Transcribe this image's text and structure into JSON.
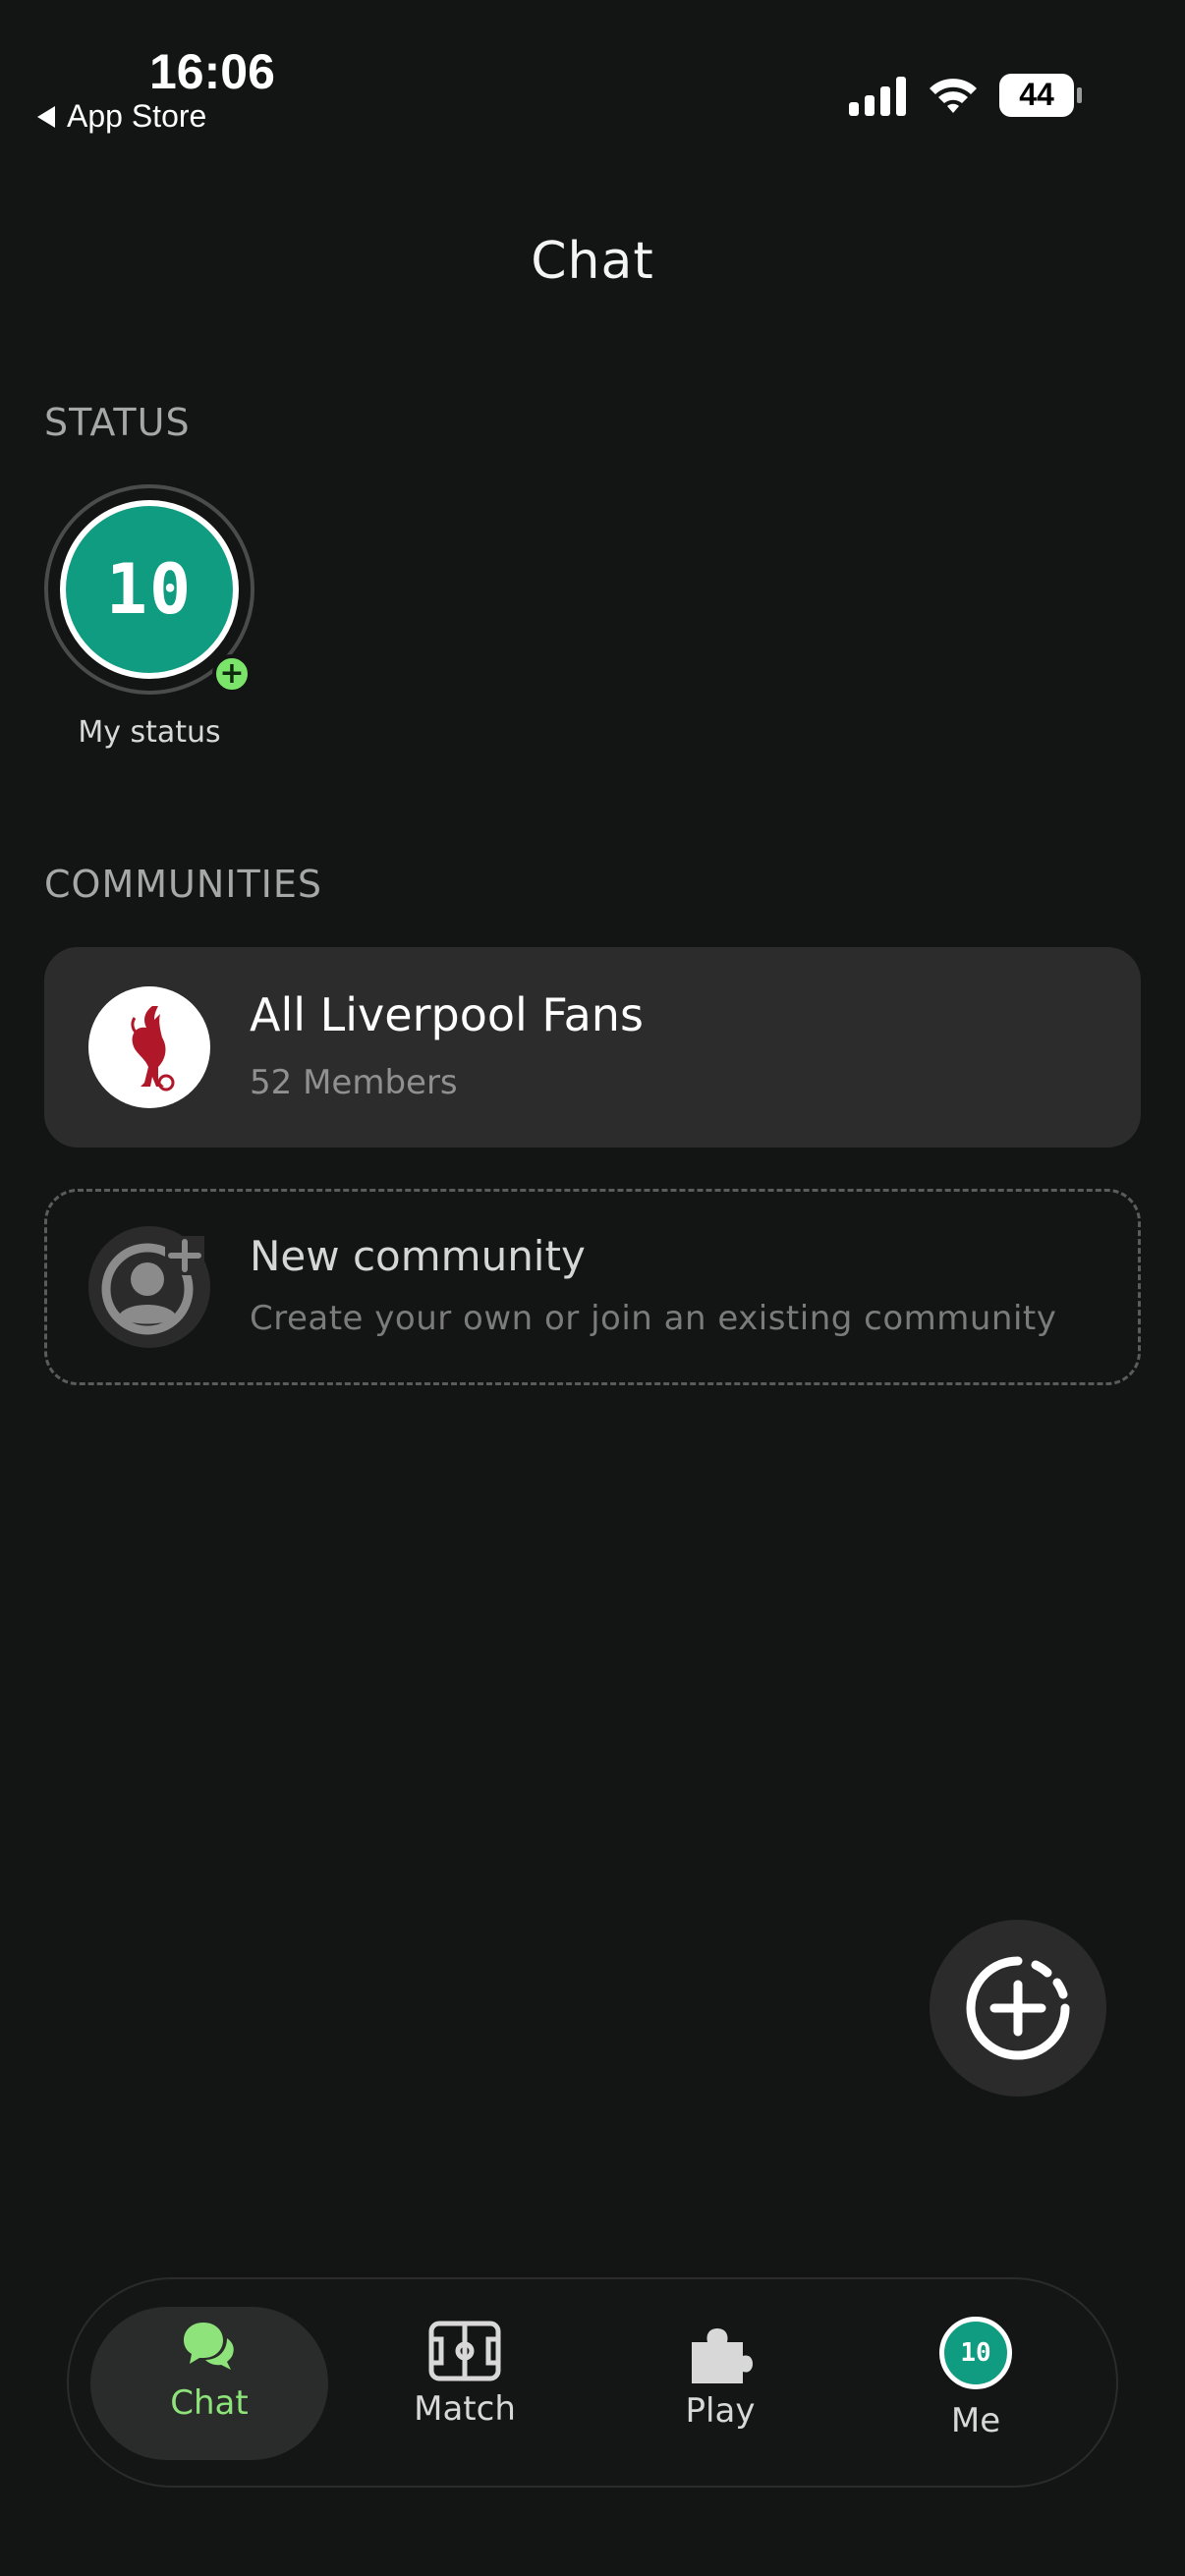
{
  "status_bar": {
    "time": "16:06",
    "back_label": "App Store",
    "battery": "44"
  },
  "header": {
    "title": "Chat"
  },
  "status_section": {
    "label": "STATUS",
    "avatar_text": "10",
    "caption": "My status"
  },
  "communities_section": {
    "label": "COMMUNITIES",
    "items": [
      {
        "name": "All Liverpool Fans",
        "members": "52 Members",
        "logo_icon": "liverbird-crest-icon"
      }
    ],
    "new_community": {
      "title": "New community",
      "subtitle": "Create your own or join an existing community"
    }
  },
  "fab": {
    "icon": "new-chat-plus-icon"
  },
  "nav": {
    "items": [
      {
        "label": "Chat",
        "icon": "chat-bubbles-icon",
        "active": true
      },
      {
        "label": "Match",
        "icon": "pitch-icon",
        "active": false
      },
      {
        "label": "Play",
        "icon": "puzzle-icon",
        "active": false
      },
      {
        "label": "Me",
        "icon": "avatar",
        "avatar_text": "10",
        "active": false
      }
    ]
  },
  "colors": {
    "background": "#131514",
    "accent_green": "#8ee47a",
    "avatar_teal": "#0f9c80",
    "card": "#2b2c2b"
  }
}
